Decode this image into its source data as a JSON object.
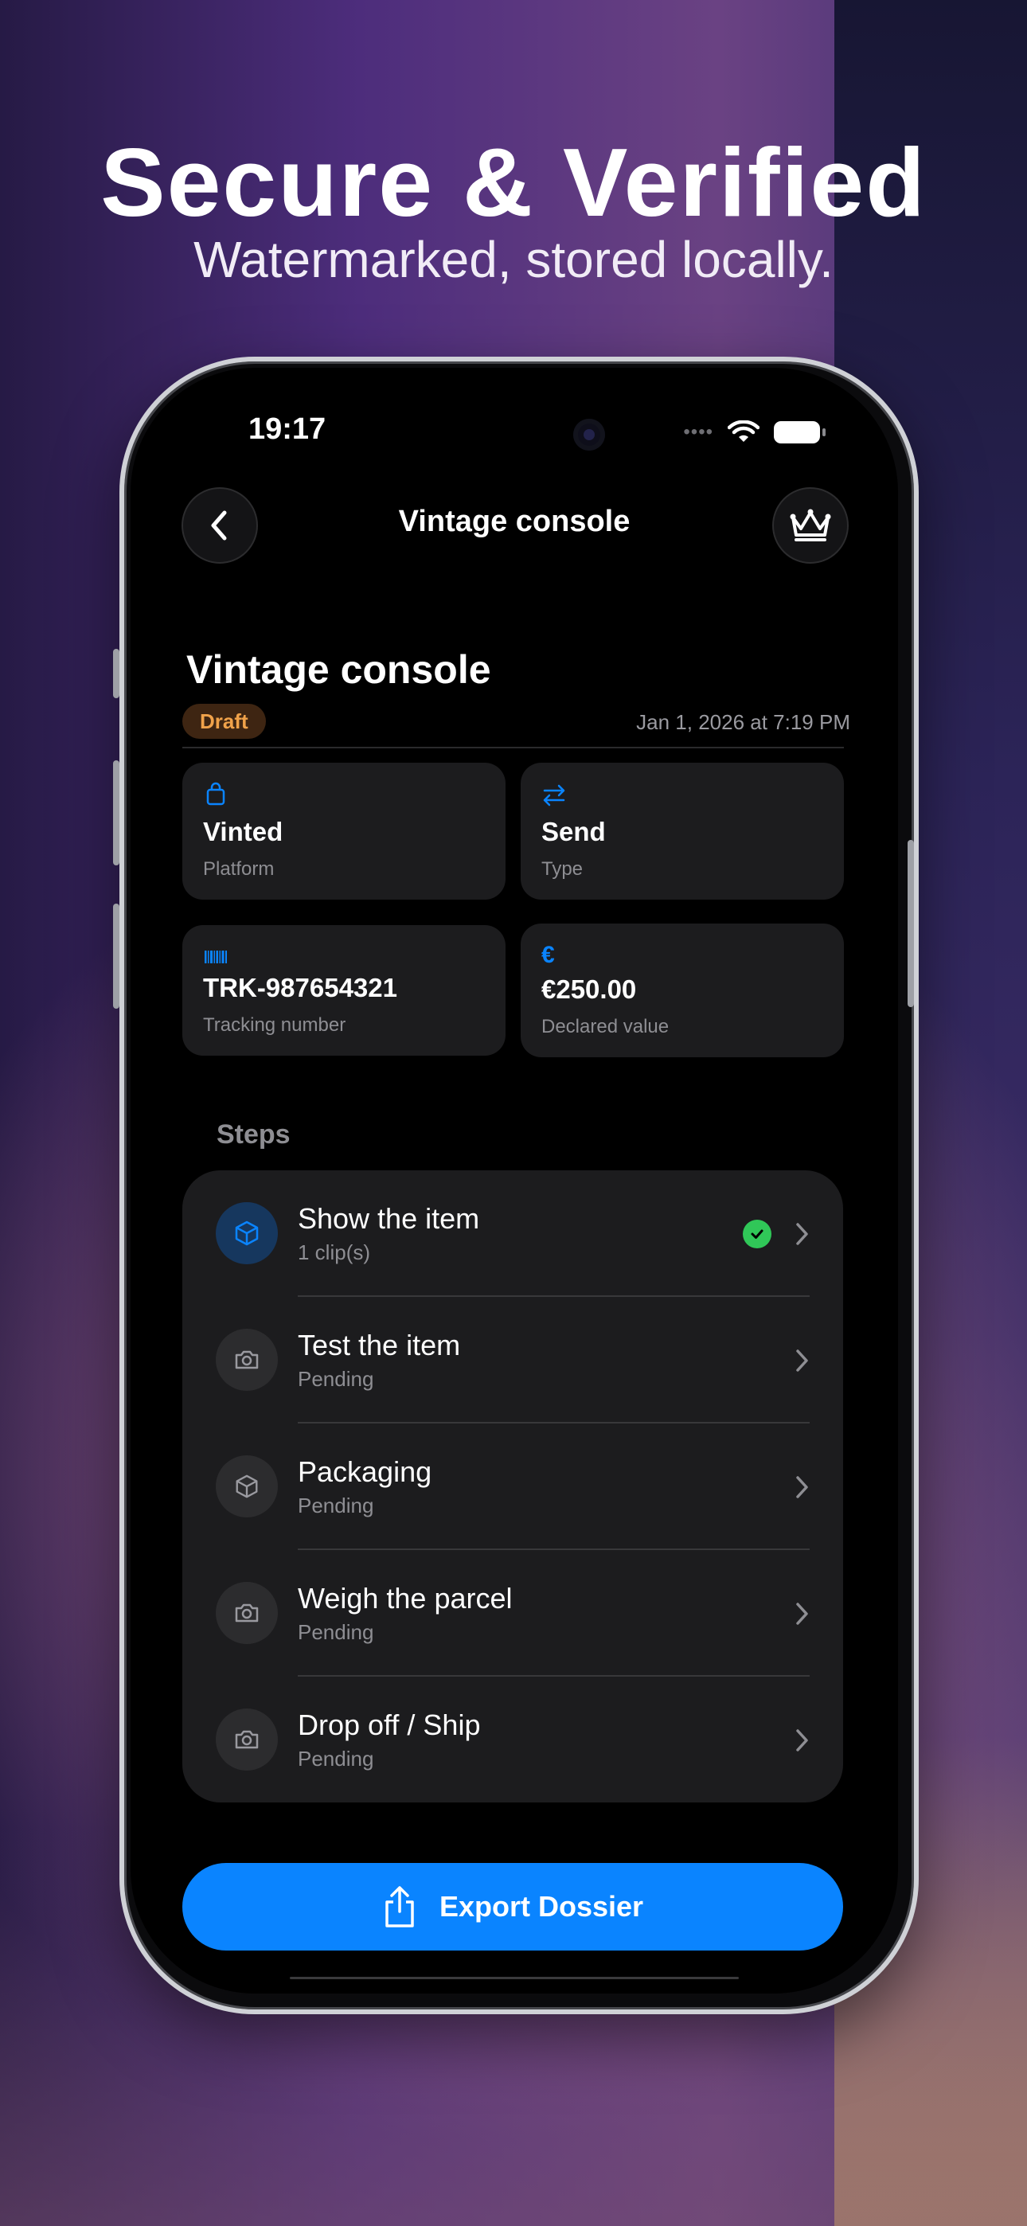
{
  "headline": "Secure & Verified",
  "subheadline": "Watermarked, stored locally.",
  "status_bar": {
    "time": "19:17",
    "dots": "••••"
  },
  "nav": {
    "title": "Vintage console",
    "back_icon": "chevron-left-icon",
    "premium_icon": "crown-icon"
  },
  "item": {
    "title": "Vintage console",
    "status_badge": "Draft",
    "date": "Jan 1, 2026 at 7:19 PM",
    "accent_color": "#0a84ff",
    "badge_color": "#f0a24a"
  },
  "cards": [
    {
      "icon": "bag-icon",
      "value": "Vinted",
      "label": "Platform"
    },
    {
      "icon": "arrows-exchange-icon",
      "value": "Send",
      "label": "Type"
    },
    {
      "icon": "barcode-icon",
      "value": "TRK-987654321",
      "label": "Tracking number"
    },
    {
      "icon": "euro-icon",
      "value": "€250.00",
      "label": "Declared value",
      "icon_glyph": "€"
    }
  ],
  "steps": {
    "title": "Steps",
    "items": [
      {
        "title": "Show the item",
        "subtitle": "1 clip(s)",
        "icon": "cube-icon",
        "completed": true
      },
      {
        "title": "Test the item",
        "subtitle": "Pending",
        "icon": "camera-icon",
        "completed": false
      },
      {
        "title": "Packaging",
        "subtitle": "Pending",
        "icon": "box-icon",
        "completed": false
      },
      {
        "title": "Weigh the parcel",
        "subtitle": "Pending",
        "icon": "camera-icon",
        "completed": false
      },
      {
        "title": "Drop off / Ship",
        "subtitle": "Pending",
        "icon": "camera-icon",
        "completed": false
      }
    ]
  },
  "export_button": {
    "label": "Export Dossier",
    "icon": "share-icon"
  }
}
